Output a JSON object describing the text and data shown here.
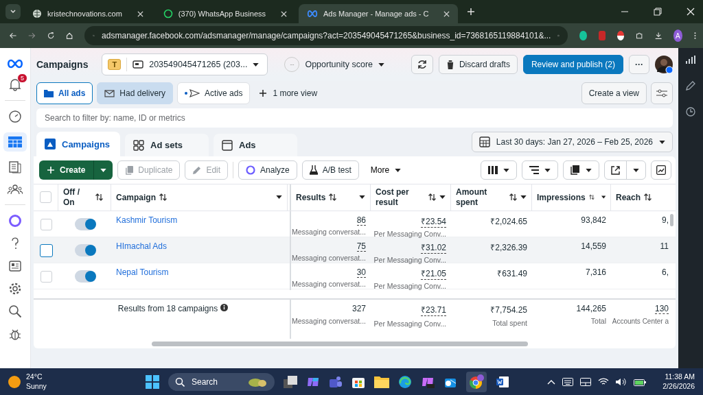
{
  "browser": {
    "tabs": [
      {
        "title": "kristechnovations.com",
        "selected": false
      },
      {
        "title": "(370) WhatsApp Business",
        "selected": false
      },
      {
        "title": "Ads Manager - Manage ads - C",
        "selected": true
      }
    ],
    "url": "adsmanager.facebook.com/adsmanager/manage/campaigns?act=203549045471265&business_id=7368165119884101&...",
    "profile_initial": "A"
  },
  "sidebar": {
    "notification_count": "5"
  },
  "header": {
    "title": "Campaigns",
    "account_badge": "T",
    "account": "203549045471265 (203...",
    "opportunity_score": "--",
    "opportunity_label": "Opportunity score",
    "discard": "Discard drafts",
    "publish": "Review and publish (2)",
    "more": "···"
  },
  "views": [
    {
      "label": "All ads",
      "selected": true,
      "hovered": false
    },
    {
      "label": "Had delivery",
      "selected": false,
      "hovered": true
    },
    {
      "label": "Active ads",
      "selected": false,
      "hovered": false
    }
  ],
  "more_views": "1 more view",
  "create_view": "Create a view",
  "search": {
    "placeholder": "Search to filter by: name, ID or metrics"
  },
  "level_tabs": [
    {
      "label": "Campaigns",
      "selected": true
    },
    {
      "label": "Ad sets",
      "selected": false
    },
    {
      "label": "Ads",
      "selected": false
    }
  ],
  "date_range": "Last 30 days: Jan 27, 2026 – Feb 25, 2026",
  "toolbar": {
    "create": "Create",
    "duplicate": {
      "label": "Duplicate",
      "disabled": true
    },
    "edit": {
      "label": "Edit",
      "disabled": true
    },
    "analyze": "Analyze",
    "ab_test": "A/B test",
    "more": "More"
  },
  "table": {
    "select_all": {
      "checked": false
    },
    "columns": [
      "Off / On",
      "Campaign",
      "Results",
      "Cost per result",
      "Amount spent",
      "Impressions",
      "Reach"
    ],
    "rows": [
      {
        "name": "Kashmir Tourism",
        "checked": false,
        "on": true,
        "hovered": false,
        "results": "86",
        "results_label": "Messaging conversat...",
        "cost": "₹23.54",
        "cost_label": "Per Messaging Conv...",
        "amount": "₹2,024.65",
        "impressions": "93,842",
        "reach": "9,"
      },
      {
        "name": "HImachal Ads",
        "checked": false,
        "on": true,
        "hovered": true,
        "results": "75",
        "results_label": "Messaging conversat...",
        "cost": "₹31.02",
        "cost_label": "Per Messaging Conv...",
        "amount": "₹2,326.39",
        "impressions": "14,559",
        "reach": "11"
      },
      {
        "name": "Nepal Tourism",
        "checked": false,
        "on": true,
        "hovered": false,
        "results": "30",
        "results_label": "Messaging conversat...",
        "cost": "₹21.05",
        "cost_label": "Per Messaging Conv...",
        "amount": "₹631.49",
        "impressions": "7,316",
        "reach": "6,"
      }
    ],
    "summary": {
      "label": "Results from 18 campaigns",
      "results": "327",
      "results_label": "Messaging conversat...",
      "cost": "₹23.71",
      "cost_label": "Per Messaging Conv...",
      "amount": "₹7,754.25",
      "amount_label": "Total spent",
      "impressions": "144,265",
      "impressions_label": "Total",
      "reach": "130",
      "reach_label": "Accounts Center a"
    }
  },
  "taskbar": {
    "temperature": "24°C",
    "weather": "Sunny",
    "search": "Search",
    "time": "11:38 AM",
    "date": "2/26/2026"
  }
}
